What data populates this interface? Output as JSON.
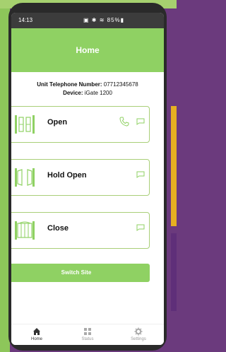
{
  "status_bar": {
    "time": "14:13",
    "indicators": "▣ ✱ ≋ 85%▮"
  },
  "header": {
    "title": "Home"
  },
  "unit_info": {
    "phone_label": "Unit Telephone Number:",
    "phone_value": "07712345678",
    "device_label": "Device:",
    "device_value": "iGate 1200"
  },
  "actions": [
    {
      "label": "Open",
      "icons": [
        "phone-icon",
        "message-icon"
      ]
    },
    {
      "label": "Hold Open",
      "icons": [
        "message-icon"
      ]
    },
    {
      "label": "Close",
      "icons": [
        "message-icon"
      ]
    }
  ],
  "switch_site_label": "Switch Site",
  "tabs": [
    {
      "label": "Home",
      "icon": "home-icon",
      "active": true
    },
    {
      "label": "Status",
      "icon": "grid-icon",
      "active": false
    },
    {
      "label": "Settings",
      "icon": "gear-icon",
      "active": false
    }
  ],
  "colors": {
    "accent": "#8fd163",
    "card_border": "#a9cf78"
  }
}
